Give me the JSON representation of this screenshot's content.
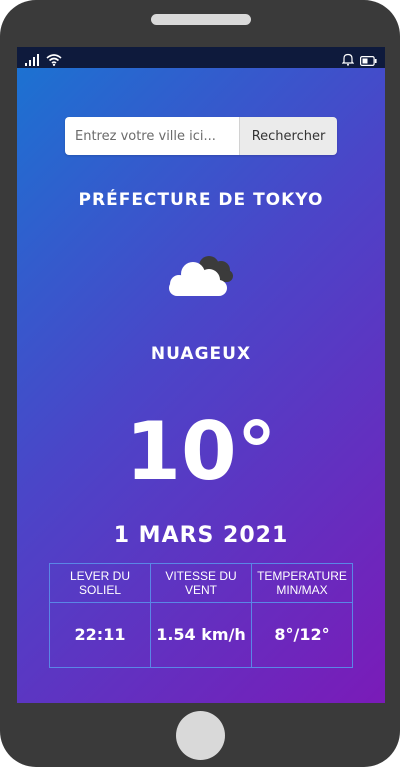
{
  "search": {
    "placeholder": "Entrez votre ville ici...",
    "button_label": "Rechercher"
  },
  "weather": {
    "city": "PRÉFECTURE DE TOKYO",
    "icon": "cloud-icon",
    "condition": "NUAGEUX",
    "temperature": "10°",
    "date": "1 MARS 2021"
  },
  "details": {
    "headers": [
      "LEVER DU SOLIEL",
      "VITESSE DU VENT",
      "TEMPERATURE MIN/MAX"
    ],
    "values": [
      "22:11",
      "1.54 km/h",
      "8°/12°"
    ]
  },
  "colors": {
    "gradient_start": "#1a74d2",
    "gradient_end": "#7a1bb8",
    "status_bar": "#0e1a3c",
    "table_border": "#5a86e6"
  }
}
